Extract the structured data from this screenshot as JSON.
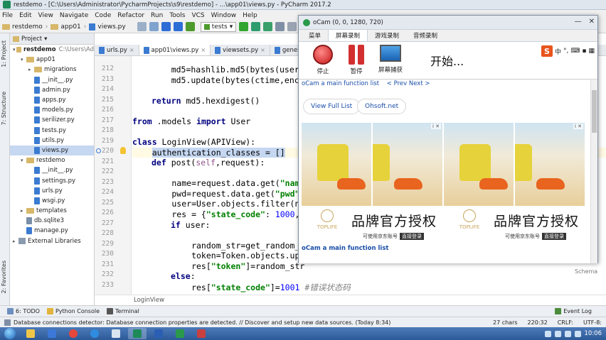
{
  "window_title": "restdemo - [C:\\Users\\Administrator\\PycharmProjects\\s9\\restdemo] - ...\\app01\\views.py - PyCharm 2017.2",
  "menu": [
    "File",
    "Edit",
    "View",
    "Navigate",
    "Code",
    "Refactor",
    "Run",
    "Tools",
    "VCS",
    "Window",
    "Help"
  ],
  "breadcrumbs": [
    "restdemo",
    "app01",
    "views.py"
  ],
  "run_config": "tests",
  "project_panel": {
    "title": "Project",
    "tree": [
      {
        "label": "restdemo",
        "extra": "C:\\Users\\Ad",
        "type": "folder",
        "depth": 0,
        "expanded": true
      },
      {
        "label": "app01",
        "type": "folder",
        "depth": 1,
        "expanded": true
      },
      {
        "label": "migrations",
        "type": "folder",
        "depth": 2,
        "expanded": false
      },
      {
        "label": "__init__.py",
        "type": "py",
        "depth": 2
      },
      {
        "label": "admin.py",
        "type": "py",
        "depth": 2
      },
      {
        "label": "apps.py",
        "type": "py",
        "depth": 2
      },
      {
        "label": "models.py",
        "type": "py",
        "depth": 2
      },
      {
        "label": "serilizer.py",
        "type": "py",
        "depth": 2
      },
      {
        "label": "tests.py",
        "type": "py",
        "depth": 2
      },
      {
        "label": "utils.py",
        "type": "py",
        "depth": 2
      },
      {
        "label": "views.py",
        "type": "py",
        "depth": 2,
        "selected": true
      },
      {
        "label": "restdemo",
        "type": "folder",
        "depth": 1,
        "expanded": true
      },
      {
        "label": "__init__.py",
        "type": "py",
        "depth": 2
      },
      {
        "label": "settings.py",
        "type": "py",
        "depth": 2
      },
      {
        "label": "urls.py",
        "type": "py",
        "depth": 2
      },
      {
        "label": "wsgi.py",
        "type": "py",
        "depth": 2
      },
      {
        "label": "templates",
        "type": "folder",
        "depth": 1
      },
      {
        "label": "db.sqlite3",
        "type": "db",
        "depth": 1
      },
      {
        "label": "manage.py",
        "type": "py",
        "depth": 1
      },
      {
        "label": "External Libraries",
        "type": "lib",
        "depth": 0,
        "expanded": false
      }
    ]
  },
  "side_tabs": {
    "project": "1: Project",
    "structure": "7: Structure",
    "favorites": "2: Favorites"
  },
  "editor_tabs": [
    {
      "label": "urls.py",
      "active": false
    },
    {
      "label": "app01\\views.py",
      "active": true
    },
    {
      "label": "viewsets.py",
      "active": false
    },
    {
      "label": "generics.py",
      "active": false
    }
  ],
  "line_numbers": [
    "212",
    "213",
    "214",
    "215",
    "216",
    "217",
    "218",
    "219",
    "220",
    "221",
    "222",
    "223",
    "224",
    "225",
    "226",
    "227",
    "228",
    "229",
    "230",
    "231",
    "232",
    "233"
  ],
  "code": {
    "l212_a": "    md5=hashlib.md5(bytes(user,enco",
    "l213_a": "    md5.update(bytes(ctime,encoding",
    "l215_kw": "return",
    "l215_b": " md5.hexdigest()",
    "l217_kw1": "from",
    "l217_b": " .models ",
    "l217_kw2": "import",
    "l217_c": " User",
    "l219_kw": "class",
    "l219_b": " LoginView(APIView):",
    "l220_hl": "authentication_classes = []",
    "l221_kw": "def",
    "l221_b": " post(",
    "l221_self": "self",
    "l221_c": ",request):",
    "l223_a": "        name=request.data.get(",
    "l223_str": "\"name",
    "l224_a": "        pwd=request.data.get(",
    "l224_str": "\"pwd\"",
    "l224_b": ")",
    "l225_a": "        user=User.objects.filter(na",
    "l226_a": "        res = {",
    "l226_str": "\"state_code\"",
    "l226_b": ": ",
    "l226_num": "1000",
    "l226_c": ",",
    "l227_kw": "if",
    "l227_b": " user:",
    "l229_a": "            random_str=get_random_s",
    "l230_a": "            token=Token.objects.upd",
    "l231_a": "            res[",
    "l231_str": "\"token\"",
    "l231_b": "]=random_str",
    "l232_kw": "else",
    "l232_b": ":",
    "l233_a": "            res[",
    "l233_str": "\"state_code\"",
    "l233_b": "]=",
    "l233_num": "1001",
    "l233_cmt": " #错误状态码"
  },
  "editor_breadcrumb": "LoginView",
  "bottom_tools": [
    "6: TODO",
    "Python Console",
    "Terminal"
  ],
  "event_log": "Event Log",
  "status": {
    "message": "Database connections detector: Database connection properties are detected. // Discover and setup new data sources. (Today 8:34)",
    "chars": "27 chars",
    "position": "220:32",
    "line_sep": "CRLF:",
    "encoding": "UTF-8:"
  },
  "taskbar": {
    "clock": "10:06"
  },
  "ocam": {
    "title": "oCam (0, 0, 1280, 720)",
    "tabs": [
      "菜单",
      "屏幕录制",
      "游戏录制",
      "音频录制"
    ],
    "tools": {
      "stop": "停止",
      "pause": "暂停",
      "capture": "屏幕捕获"
    },
    "status_text": "开始...",
    "ime": {
      "logo": "S",
      "lang": "中"
    },
    "links": {
      "main": "oCam a main function list",
      "prev_next": "< Prev Next >"
    },
    "buttons": {
      "view_list": "View Full List",
      "ohsoft": "Ohsoft.net"
    },
    "ads": {
      "title": "品牌官方授权",
      "logo_text": "TOPLIFE",
      "note": "可使用京东账号",
      "login": "直接登录"
    },
    "bottom_link": "oCam a main function list"
  },
  "right_edge_text": "Schema"
}
